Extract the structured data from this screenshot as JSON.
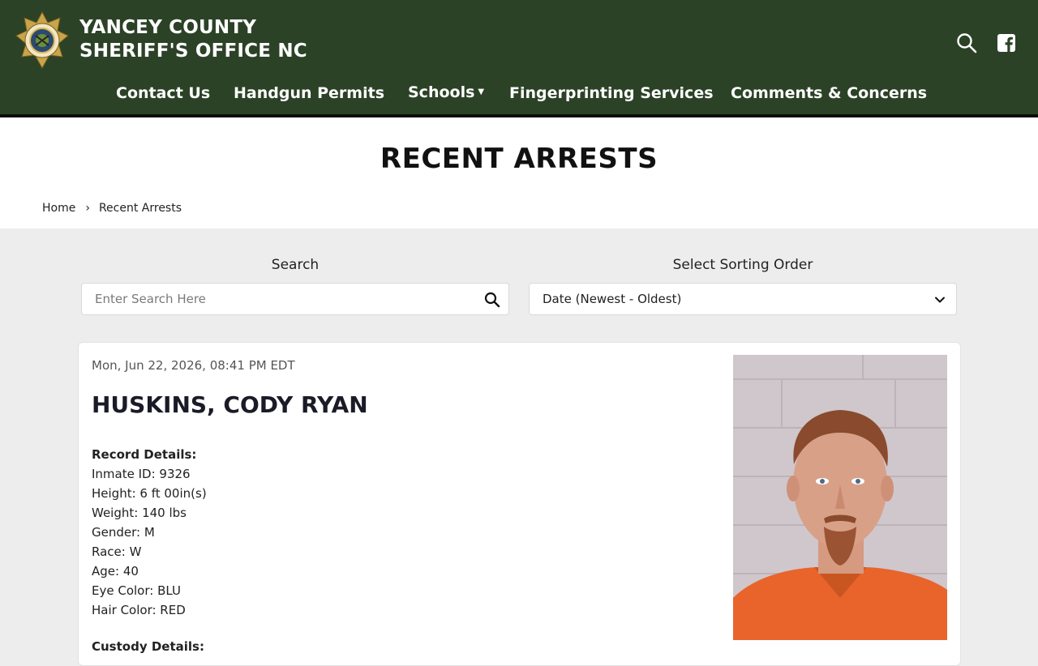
{
  "header": {
    "title_line1": "YANCEY COUNTY",
    "title_line2": "SHERIFF'S OFFICE NC",
    "search_icon": "search-icon",
    "facebook_icon": "facebook-icon",
    "colors": {
      "header_bg": "#2c4227",
      "accent_border": "#0d0d0d"
    }
  },
  "nav": {
    "items": [
      {
        "label": "Contact Us"
      },
      {
        "label": "Handgun Permits"
      },
      {
        "label": "Schools",
        "has_dropdown": true
      },
      {
        "label": "Fingerprinting Services"
      },
      {
        "label": "Comments & Concerns"
      }
    ]
  },
  "page": {
    "title": "RECENT ARRESTS",
    "breadcrumb": {
      "home": "Home",
      "separator": "›",
      "current": "Recent Arrests"
    }
  },
  "filters": {
    "search_label": "Search",
    "search_placeholder": "Enter Search Here",
    "sort_label": "Select Sorting Order",
    "sort_value": "Date (Newest - Oldest)"
  },
  "record": {
    "timestamp": "Mon, Jun 22, 2026, 08:41 PM EDT",
    "name": "HUSKINS, CODY RYAN",
    "details_heading": "Record Details:",
    "details": [
      "Inmate ID: 9326",
      "Height: 6 ft 00in(s)",
      "Weight: 140 lbs",
      "Gender: M",
      "Race: W",
      "Age: 40",
      "Eye Color: BLU",
      "Hair Color: RED"
    ],
    "custody_heading": "Custody Details:"
  }
}
